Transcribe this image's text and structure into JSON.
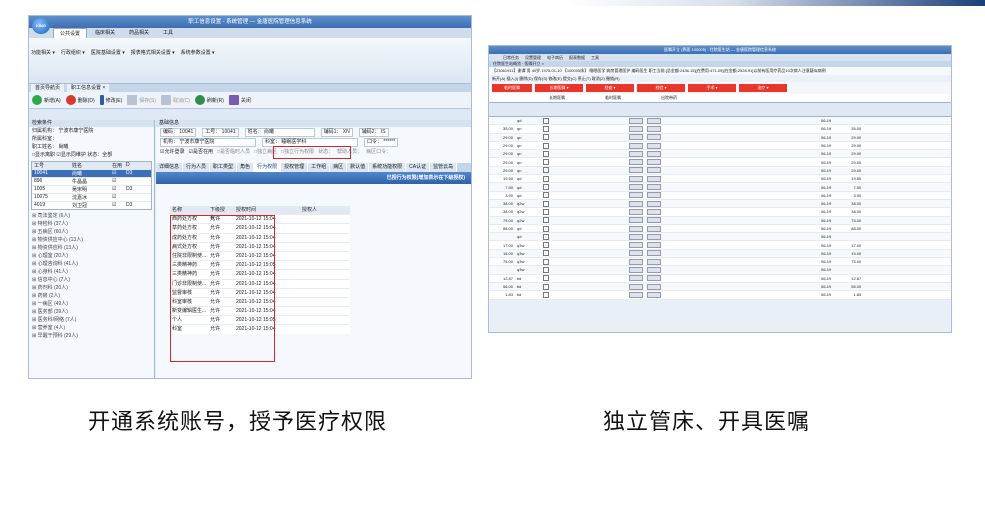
{
  "left_shot": {
    "title": "职工信息设置 - 系统管理 — 金唐医院管理信息系统",
    "logo_text": "KING",
    "tabs": [
      "公共设置",
      "临床相关",
      "药品相关",
      "工具"
    ],
    "ribbon": [
      "功能相关 ▾",
      "行政组织 ▾",
      "医院基础设置 ▾",
      "报表格式相关设置 ▾",
      "系统参数设置 ▾"
    ],
    "doc_tabs": [
      "首页导航页",
      "职工信息设置 ×"
    ],
    "toolbar": [
      "新增(A)",
      "删除(D)",
      "修改(E)",
      "保存(S)",
      "取消(C)",
      "刷新(R)",
      "关闭"
    ],
    "left_panel": {
      "header": "检索条件",
      "filters": [
        "归属机构： 宁波市康宁医院",
        "所属科室：",
        "职工姓名： 尚曦"
      ],
      "checks": "□显示离职  ☑显示同维护  状态：全部",
      "grid_headers": [
        "工号",
        "姓名",
        "在用",
        "D"
      ],
      "grid_rows": [
        [
          "10041",
          "尚曦",
          "☑",
          "D3"
        ],
        [
          "896",
          "牛晶晶",
          "☑",
          ""
        ],
        [
          "1005",
          "吴宋明",
          "☑",
          "D3"
        ],
        [
          "10075",
          "沈嘉冰",
          "☑",
          ""
        ],
        [
          "4019",
          "刘卫冠",
          "☑",
          "D3"
        ]
      ],
      "tree": [
        "⊞ 司法鉴定 (6人)",
        "⊞ 特检科 (37人)",
        "⊞ 五病区 (60人)",
        "⊞ 物资供应中心 (13人)",
        "⊞ 物资供应科 (13人)",
        "⊞ 心理室 (20人)",
        "⊞ 心理咨询科 (41人)",
        "⊞ 心身科 (41人)",
        "⊞ 信息中心 (7人)",
        "⊞ 药剂科 (20人)",
        "⊞ 药房 (2人)",
        "⊞ 一病区 (49人)",
        "⊞ 医务部 (39人)",
        "⊞ 医务科/网络 (7人)",
        "⊞ 营养室 (4人)",
        "⊞ 早醒干预科 (29人)"
      ]
    },
    "right_panel": {
      "header": "基础信息",
      "form": [
        [
          "编码： 10041",
          "工号： 10041",
          "姓名： 尚曦",
          "辅码1： XN",
          "辅码2： IS"
        ],
        [
          "机构： 宁波市康宁医院",
          "科室： 睡眠医学科",
          "口令： ******"
        ],
        [
          "☑允许登录",
          "☑是否在用",
          "□是否临时人员",
          "□独立病区",
          "□独立行为权限",
          "状态：",
          "帮助人员：",
          "病区口令："
        ]
      ],
      "tabs": [
        "详细信息",
        "行为人员",
        "职工类型",
        "角色",
        "行为权限",
        "授权管理",
        "工作组",
        "病区",
        "默认值",
        "系统功能权限",
        "CA认证",
        "监管云岛"
      ],
      "active_tab": "行为权限",
      "blue_bar": "已授行为权限(增加表示在下级授权)",
      "perm_headers": [
        "名称",
        "下级授权",
        "授权时间",
        "授权人"
      ],
      "perm_rows": [
        [
          "西药处方权",
          "允许",
          "2021-10-12 15:04",
          ""
        ],
        [
          "草药处方权",
          "允许",
          "2021-10-12 15:04",
          ""
        ],
        [
          "成药处方权",
          "允许",
          "2021-10-12 15:04",
          ""
        ],
        [
          "病式处方权",
          "允许",
          "2021-10-12 15:04",
          ""
        ],
        [
          "住院非限制使...",
          "允许",
          "2021-10-12 15:04",
          ""
        ],
        [
          "三类精神药",
          "允许",
          "2021-10-12 15:05",
          ""
        ],
        [
          "三类精神药",
          "允许",
          "2021-10-12 15:04",
          ""
        ],
        [
          "门诊非限制使...",
          "允许",
          "2021-10-12 15:04",
          ""
        ],
        [
          "监督审核",
          "允许",
          "2021-10-12 15:04",
          ""
        ],
        [
          "科室审核",
          "允许",
          "2021-10-12 15:04",
          ""
        ],
        [
          "新变编辑医生...",
          "允许",
          "2021-10-12 15:04",
          ""
        ],
        [
          "个人",
          "允许",
          "2021-10-12 15:05",
          ""
        ],
        [
          "科室",
          "允许",
          "2021-10-12 15:04",
          ""
        ]
      ]
    }
  },
  "right_shot": {
    "title": "医嘱开立 (界面 100005) - 住院医生站 — 金唐医院管理信息系统",
    "menu": [
      "日常任务",
      "设置管理",
      "电子病历",
      "报表数据",
      "工具"
    ],
    "doc_tab": "住院医生站概览 · 医嘱开立 ×",
    "info": "【23061911】谢谭  男  40岁.1975-01-10  【100005床】 睡眠医学  病房管理医护  编码医生  职工当前:[总金额:2436.15](在费用:471.09)[在金额:2528.91]以前有医用疗药品10次病人注意疑似病例",
    "toolbar": "新开(A)  插入(I)  删除(D)  保存(S)  修改(E)  提交(C)  停止(T)  取消(Z)  撤销(R)",
    "red_buttons": [
      "临时医嘱",
      "长期医嘱 ▾",
      "检查 ▾",
      "检验 ▾",
      "手术 ▾",
      "治疗 ▾"
    ],
    "filter_groups": [
      "长期医嘱",
      "临时医嘱",
      "出院带药"
    ],
    "rows": [
      [
        "",
        "qd",
        "1.00"
      ],
      [
        "35.00",
        "qn",
        ""
      ],
      [
        "29.00",
        "qn",
        ""
      ],
      [
        "29.00",
        "qn",
        ""
      ],
      [
        "29.00",
        "qn",
        ""
      ],
      [
        "29.00",
        "qn",
        ""
      ],
      [
        "29.00",
        "qn",
        ""
      ],
      [
        "19.50",
        "qd",
        ""
      ],
      [
        "7.50",
        "qd",
        ""
      ],
      [
        "3.90",
        "qd",
        ""
      ],
      [
        "38.00",
        "q2w",
        ""
      ],
      [
        "38.00",
        "q2w",
        ""
      ],
      [
        "75.00",
        "q2w",
        ""
      ],
      [
        "88.00",
        "qd",
        ""
      ],
      [
        "",
        "qd",
        ""
      ],
      [
        "17.00",
        "q3w",
        ""
      ],
      [
        "15.00",
        "q3w",
        ""
      ],
      [
        "75.00",
        "q3w",
        ""
      ],
      [
        "",
        "q3w",
        ""
      ],
      [
        "12.87",
        "tid",
        ""
      ],
      [
        "56.00",
        "tid",
        ""
      ],
      [
        "1.83",
        "tid",
        ""
      ]
    ],
    "date_label": "06-19"
  },
  "captions": {
    "left": "开通系统账号，授予医疗权限",
    "right": "独立管床、开具医嘱"
  },
  "colors": {
    "accent_red": "#d6262b",
    "brand_blue": "#3c6fb3"
  }
}
